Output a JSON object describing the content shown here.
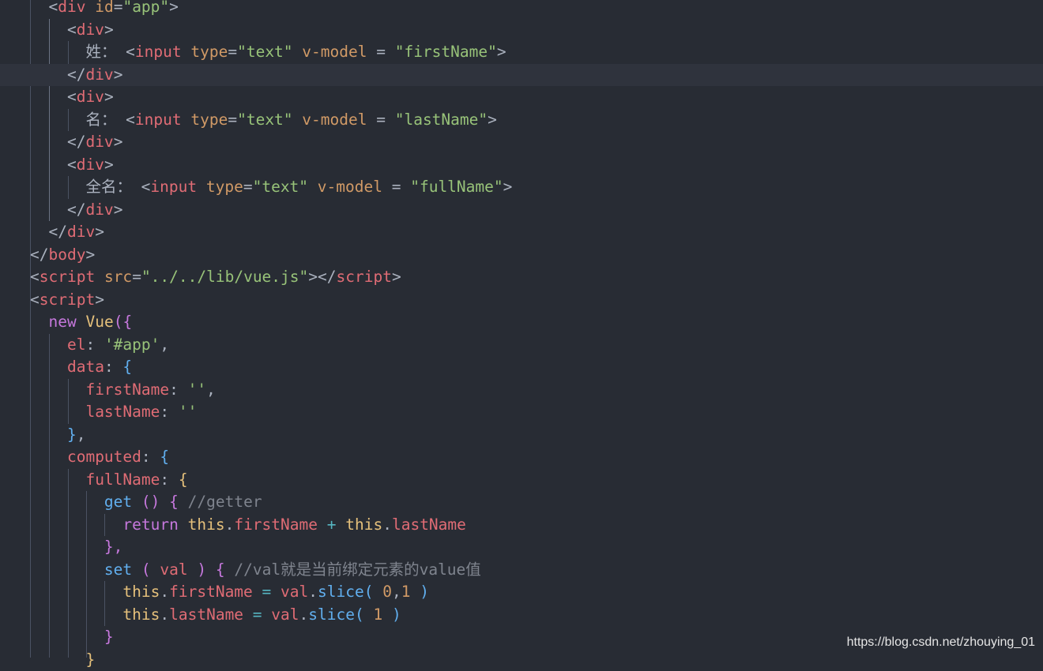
{
  "colors": {
    "background": "#282c34",
    "tag": "#e06c75",
    "attr": "#d19a66",
    "string": "#98c379",
    "plain": "#abb2bf",
    "keyword": "#c678dd",
    "func": "#61afef",
    "cls": "#e5c07b",
    "comment": "#7f848e",
    "number": "#d19a66",
    "op": "#56b6c2"
  },
  "watermark": "https://blog.csdn.net/zhouying_01",
  "lines": [
    [
      [
        "plain",
        "  "
      ],
      [
        "plain",
        "<"
      ],
      [
        "tag",
        "div"
      ],
      [
        "plain",
        " "
      ],
      [
        "attr",
        "id"
      ],
      [
        "plain",
        "="
      ],
      [
        "string",
        "\"app\""
      ],
      [
        "plain",
        ">"
      ]
    ],
    [
      [
        "plain",
        "    <"
      ],
      [
        "tag",
        "div"
      ],
      [
        "plain",
        ">"
      ]
    ],
    [
      [
        "plain",
        "      姓： <"
      ],
      [
        "tag",
        "input"
      ],
      [
        "plain",
        " "
      ],
      [
        "attr",
        "type"
      ],
      [
        "plain",
        "="
      ],
      [
        "string",
        "\"text\""
      ],
      [
        "plain",
        " "
      ],
      [
        "attr",
        "v-model"
      ],
      [
        "plain",
        " = "
      ],
      [
        "string",
        "\"firstName\""
      ],
      [
        "plain",
        ">"
      ]
    ],
    [
      [
        "plain",
        "    </"
      ],
      [
        "tag",
        "div"
      ],
      [
        "plain",
        ">"
      ]
    ],
    [
      [
        "plain",
        "    <"
      ],
      [
        "tag",
        "div"
      ],
      [
        "plain",
        ">"
      ]
    ],
    [
      [
        "plain",
        "      名： <"
      ],
      [
        "tag",
        "input"
      ],
      [
        "plain",
        " "
      ],
      [
        "attr",
        "type"
      ],
      [
        "plain",
        "="
      ],
      [
        "string",
        "\"text\""
      ],
      [
        "plain",
        " "
      ],
      [
        "attr",
        "v-model"
      ],
      [
        "plain",
        " = "
      ],
      [
        "string",
        "\"lastName\""
      ],
      [
        "plain",
        ">"
      ]
    ],
    [
      [
        "plain",
        "    </"
      ],
      [
        "tag",
        "div"
      ],
      [
        "plain",
        ">"
      ]
    ],
    [
      [
        "plain",
        "    <"
      ],
      [
        "tag",
        "div"
      ],
      [
        "plain",
        ">"
      ]
    ],
    [
      [
        "plain",
        "      全名： <"
      ],
      [
        "tag",
        "input"
      ],
      [
        "plain",
        " "
      ],
      [
        "attr",
        "type"
      ],
      [
        "plain",
        "="
      ],
      [
        "string",
        "\"text\""
      ],
      [
        "plain",
        " "
      ],
      [
        "attr",
        "v-model"
      ],
      [
        "plain",
        " = "
      ],
      [
        "string",
        "\"fullName\""
      ],
      [
        "plain",
        ">"
      ]
    ],
    [
      [
        "plain",
        "    </"
      ],
      [
        "tag",
        "div"
      ],
      [
        "plain",
        ">"
      ]
    ],
    [
      [
        "plain",
        "  </"
      ],
      [
        "tag",
        "div"
      ],
      [
        "plain",
        ">"
      ]
    ],
    [
      [
        "plain",
        "</"
      ],
      [
        "tag",
        "body"
      ],
      [
        "plain",
        ">"
      ]
    ],
    [
      [
        "plain",
        "<"
      ],
      [
        "tag",
        "script"
      ],
      [
        "plain",
        " "
      ],
      [
        "attr",
        "src"
      ],
      [
        "plain",
        "="
      ],
      [
        "string",
        "\"../../lib/vue.js\""
      ],
      [
        "plain",
        "></"
      ],
      [
        "tag",
        "script"
      ],
      [
        "plain",
        ">"
      ]
    ],
    [
      [
        "plain",
        "<"
      ],
      [
        "tag",
        "script"
      ],
      [
        "plain",
        ">"
      ]
    ],
    [
      [
        "plain",
        "  "
      ],
      [
        "keyword",
        "new"
      ],
      [
        "plain",
        " "
      ],
      [
        "cls",
        "Vue"
      ],
      [
        "keyword",
        "({"
      ]
    ],
    [
      [
        "plain",
        "    "
      ],
      [
        "tag",
        "el"
      ],
      [
        "plain",
        ": "
      ],
      [
        "string",
        "'#app'"
      ],
      [
        "plain",
        ","
      ]
    ],
    [
      [
        "plain",
        "    "
      ],
      [
        "tag",
        "data"
      ],
      [
        "plain",
        ": "
      ],
      [
        "func",
        "{"
      ]
    ],
    [
      [
        "plain",
        "      "
      ],
      [
        "tag",
        "firstName"
      ],
      [
        "plain",
        ": "
      ],
      [
        "string",
        "''"
      ],
      [
        "plain",
        ","
      ]
    ],
    [
      [
        "plain",
        "      "
      ],
      [
        "tag",
        "lastName"
      ],
      [
        "plain",
        ": "
      ],
      [
        "string",
        "''"
      ]
    ],
    [
      [
        "plain",
        "    "
      ],
      [
        "func",
        "}"
      ],
      [
        "plain",
        ","
      ]
    ],
    [
      [
        "plain",
        "    "
      ],
      [
        "tag",
        "computed"
      ],
      [
        "plain",
        ": "
      ],
      [
        "func",
        "{"
      ]
    ],
    [
      [
        "plain",
        "      "
      ],
      [
        "tag",
        "fullName"
      ],
      [
        "plain",
        ": "
      ],
      [
        "cls",
        "{"
      ]
    ],
    [
      [
        "plain",
        "        "
      ],
      [
        "func",
        "get"
      ],
      [
        "plain",
        " "
      ],
      [
        "keyword",
        "()"
      ],
      [
        "plain",
        " "
      ],
      [
        "keyword",
        "{"
      ],
      [
        "plain",
        " "
      ],
      [
        "comment",
        "//getter"
      ]
    ],
    [
      [
        "plain",
        "          "
      ],
      [
        "keyword",
        "return"
      ],
      [
        "plain",
        " "
      ],
      [
        "cls",
        "this"
      ],
      [
        "plain",
        "."
      ],
      [
        "tag",
        "firstName"
      ],
      [
        "plain",
        " "
      ],
      [
        "op",
        "+"
      ],
      [
        "plain",
        " "
      ],
      [
        "cls",
        "this"
      ],
      [
        "plain",
        "."
      ],
      [
        "tag",
        "lastName"
      ]
    ],
    [
      [
        "plain",
        "        "
      ],
      [
        "keyword",
        "},"
      ]
    ],
    [
      [
        "plain",
        "        "
      ],
      [
        "func",
        "set"
      ],
      [
        "plain",
        " "
      ],
      [
        "keyword",
        "("
      ],
      [
        "plain",
        " "
      ],
      [
        "tag",
        "val"
      ],
      [
        "plain",
        " "
      ],
      [
        "keyword",
        ")"
      ],
      [
        "plain",
        " "
      ],
      [
        "keyword",
        "{"
      ],
      [
        "plain",
        " "
      ],
      [
        "comment",
        "//val就是当前绑定元素的value值"
      ]
    ],
    [
      [
        "plain",
        "          "
      ],
      [
        "cls",
        "this"
      ],
      [
        "plain",
        "."
      ],
      [
        "tag",
        "firstName"
      ],
      [
        "plain",
        " "
      ],
      [
        "op",
        "="
      ],
      [
        "plain",
        " "
      ],
      [
        "tag",
        "val"
      ],
      [
        "plain",
        "."
      ],
      [
        "func",
        "slice"
      ],
      [
        "func",
        "("
      ],
      [
        "plain",
        " "
      ],
      [
        "number",
        "0"
      ],
      [
        "plain",
        ","
      ],
      [
        "number",
        "1"
      ],
      [
        "plain",
        " "
      ],
      [
        "func",
        ")"
      ]
    ],
    [
      [
        "plain",
        "          "
      ],
      [
        "cls",
        "this"
      ],
      [
        "plain",
        "."
      ],
      [
        "tag",
        "lastName"
      ],
      [
        "plain",
        " "
      ],
      [
        "op",
        "="
      ],
      [
        "plain",
        " "
      ],
      [
        "tag",
        "val"
      ],
      [
        "plain",
        "."
      ],
      [
        "func",
        "slice"
      ],
      [
        "func",
        "("
      ],
      [
        "plain",
        " "
      ],
      [
        "number",
        "1"
      ],
      [
        "plain",
        " "
      ],
      [
        "func",
        ")"
      ]
    ],
    [
      [
        "plain",
        "        "
      ],
      [
        "keyword",
        "}"
      ]
    ],
    [
      [
        "plain",
        "      "
      ],
      [
        "cls",
        "}"
      ]
    ]
  ]
}
